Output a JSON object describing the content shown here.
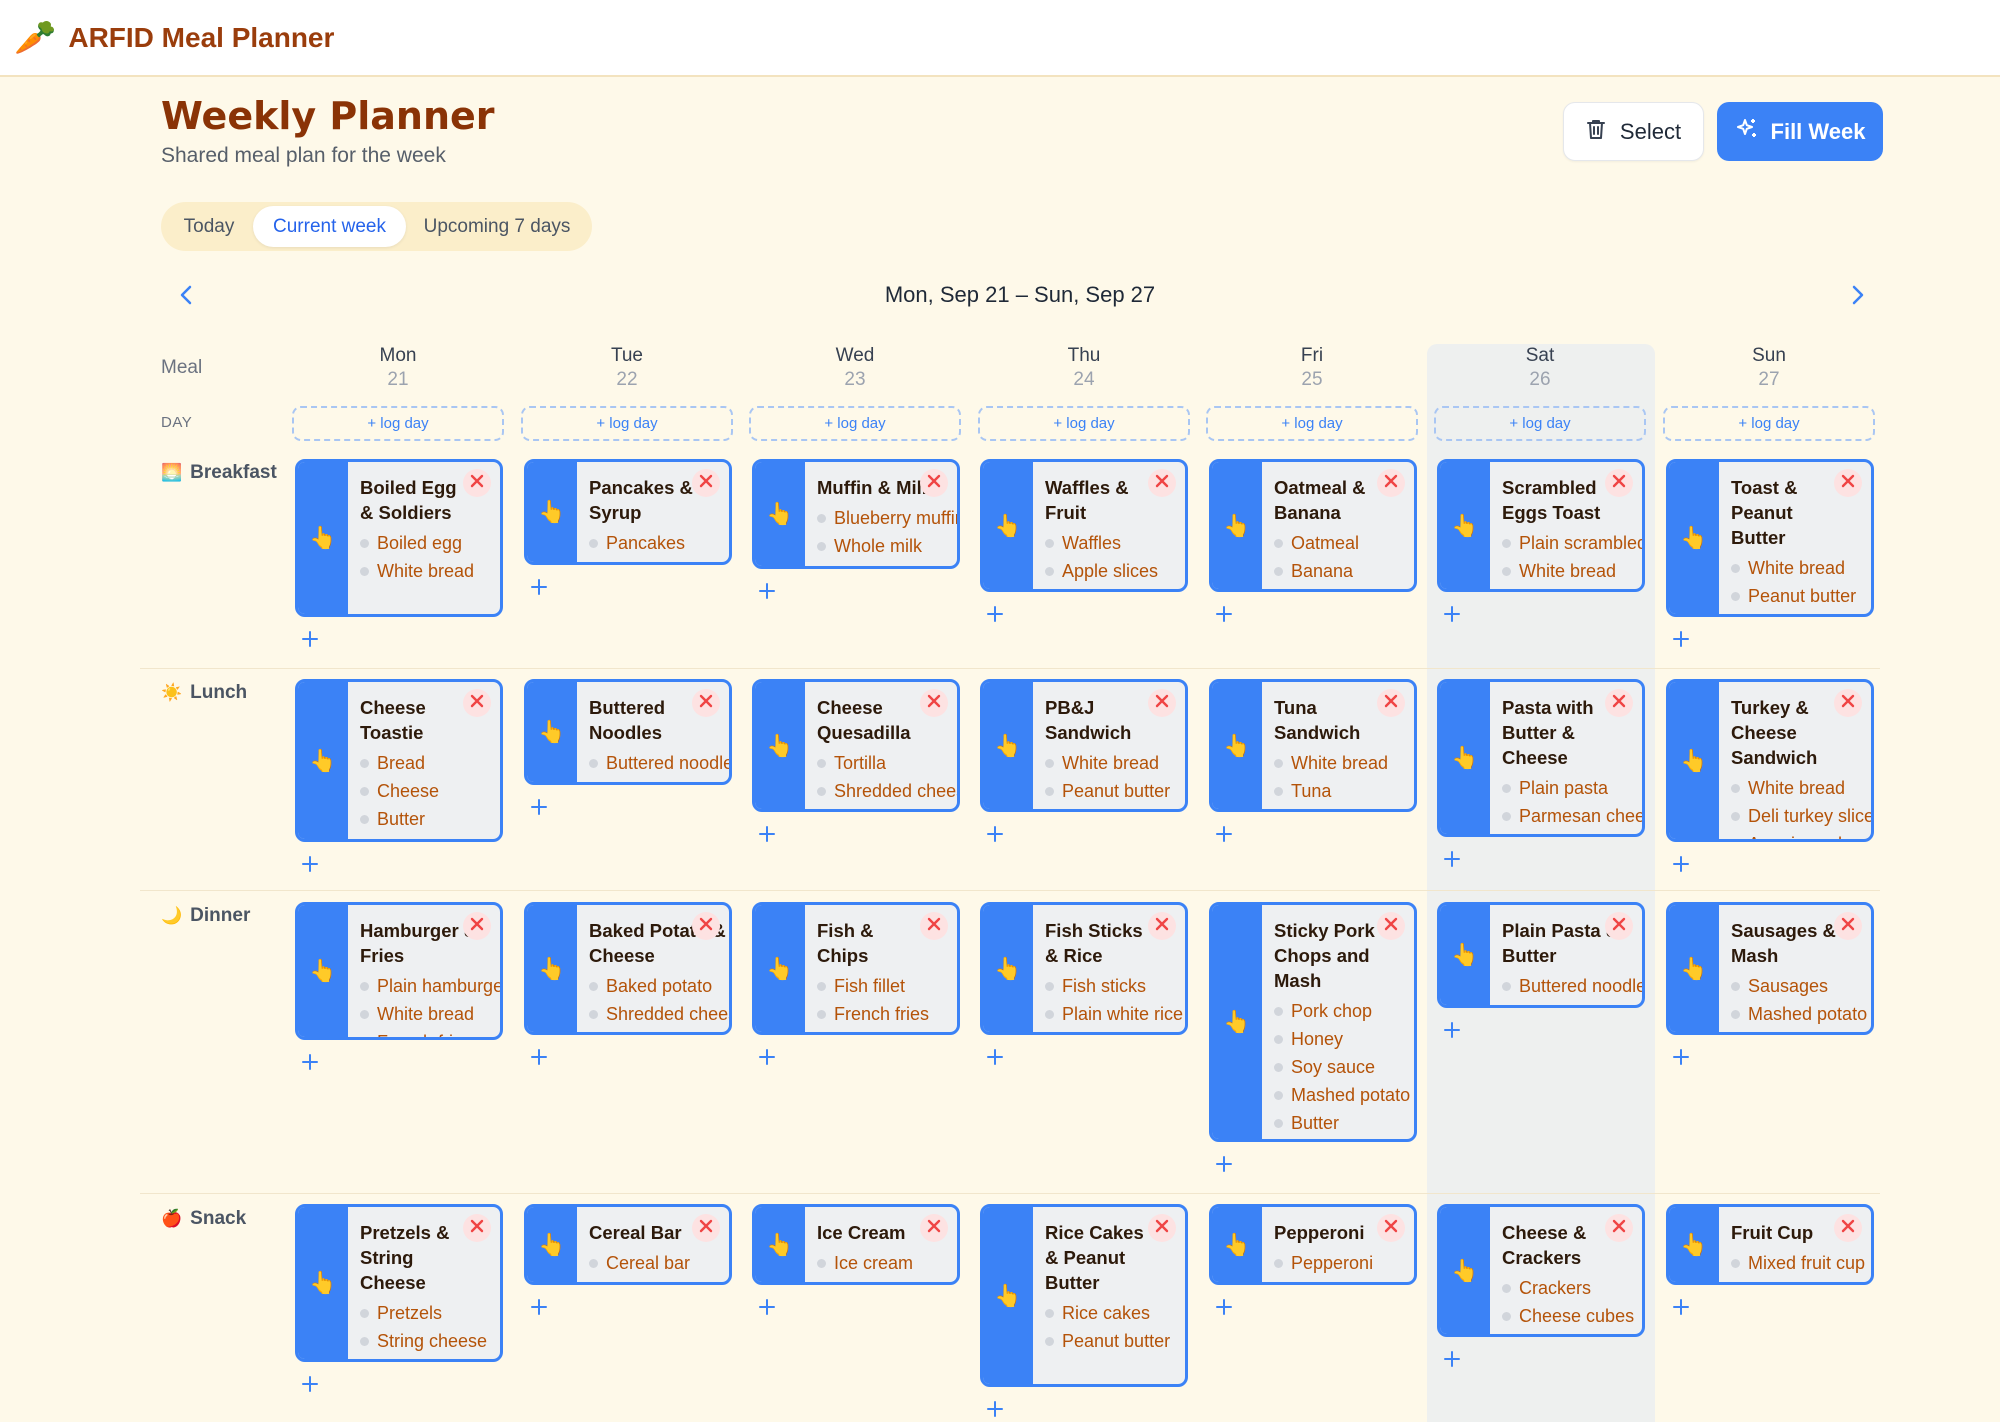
{
  "app": {
    "title": "ARFID Meal Planner",
    "logo_icon": "carrot-icon"
  },
  "header": {
    "title": "Weekly Planner",
    "subtitle": "Shared meal plan for the week"
  },
  "actions": {
    "select_label": "Select",
    "fill_week_label": "Fill Week"
  },
  "tabs": [
    {
      "label": "Today",
      "active": false
    },
    {
      "label": "Current week",
      "active": true
    },
    {
      "label": "Upcoming 7 days",
      "active": false
    }
  ],
  "date_range": "Mon, Sep 21 – Sun, Sep 27",
  "grid": {
    "meal_column_label": "Meal",
    "day_row_label": "DAY",
    "log_day_label": "+ log day",
    "highlighted_day": "Sat",
    "days": [
      {
        "name": "Mon",
        "num": "21"
      },
      {
        "name": "Tue",
        "num": "22"
      },
      {
        "name": "Wed",
        "num": "23"
      },
      {
        "name": "Thu",
        "num": "24"
      },
      {
        "name": "Fri",
        "num": "25"
      },
      {
        "name": "Sat",
        "num": "26"
      },
      {
        "name": "Sun",
        "num": "27"
      }
    ]
  },
  "rows": [
    {
      "label": "Breakfast",
      "emoji": "🌅",
      "meals": [
        {
          "title": "Boiled Egg & Soldiers",
          "items": [
            "Boiled egg",
            "White bread"
          ]
        },
        {
          "title": "Pancakes & Syrup",
          "items": [
            "Pancakes"
          ]
        },
        {
          "title": "Muffin & Milk",
          "items": [
            "Blueberry muffin",
            "Whole milk"
          ]
        },
        {
          "title": "Waffles & Fruit",
          "items": [
            "Waffles",
            "Apple slices"
          ]
        },
        {
          "title": "Oatmeal & Banana",
          "items": [
            "Oatmeal",
            "Banana"
          ]
        },
        {
          "title": "Scrambled Eggs Toast",
          "items": [
            "Plain scrambled eggs",
            "White bread"
          ]
        },
        {
          "title": "Toast & Peanut Butter",
          "items": [
            "White bread",
            "Peanut butter"
          ]
        }
      ]
    },
    {
      "label": "Lunch",
      "emoji": "☀️",
      "meals": [
        {
          "title": "Cheese Toastie",
          "items": [
            "Bread",
            "Cheese",
            "Butter"
          ]
        },
        {
          "title": "Buttered Noodles",
          "items": [
            "Buttered noodles"
          ]
        },
        {
          "title": "Cheese Quesadilla",
          "items": [
            "Tortilla",
            "Shredded cheese"
          ]
        },
        {
          "title": "PB&J Sandwich",
          "items": [
            "White bread",
            "Peanut butter"
          ]
        },
        {
          "title": "Tuna Sandwich",
          "items": [
            "White bread",
            "Tuna"
          ]
        },
        {
          "title": "Pasta with Butter & Cheese",
          "items": [
            "Plain pasta",
            "Parmesan cheese"
          ]
        },
        {
          "title": "Turkey & Cheese Sandwich",
          "items": [
            "White bread",
            "Deli turkey slices",
            "American cheese"
          ]
        }
      ]
    },
    {
      "label": "Dinner",
      "emoji": "🌙",
      "meals": [
        {
          "title": "Hamburger & Fries",
          "items": [
            "Plain hamburger",
            "White bread",
            "French fries"
          ]
        },
        {
          "title": "Baked Potato & Cheese",
          "items": [
            "Baked potato",
            "Shredded cheese"
          ]
        },
        {
          "title": "Fish & Chips",
          "items": [
            "Fish fillet",
            "French fries"
          ]
        },
        {
          "title": "Fish Sticks & Rice",
          "items": [
            "Fish sticks",
            "Plain white rice"
          ]
        },
        {
          "title": "Sticky Pork Chops and Mash",
          "items": [
            "Pork chop",
            "Honey",
            "Soy sauce",
            "Mashed potato",
            "Butter"
          ]
        },
        {
          "title": "Plain Pasta & Butter",
          "items": [
            "Buttered noodles"
          ]
        },
        {
          "title": "Sausages & Mash",
          "items": [
            "Sausages",
            "Mashed potato"
          ]
        }
      ]
    },
    {
      "label": "Snack",
      "emoji": "🍎",
      "meals": [
        {
          "title": "Pretzels & String Cheese",
          "items": [
            "Pretzels",
            "String cheese"
          ]
        },
        {
          "title": "Cereal Bar",
          "items": [
            "Cereal bar"
          ]
        },
        {
          "title": "Ice Cream",
          "items": [
            "Ice cream"
          ]
        },
        {
          "title": "Rice Cakes & Peanut Butter",
          "items": [
            "Rice cakes",
            "Peanut butter"
          ]
        },
        {
          "title": "Pepperoni",
          "items": [
            "Pepperoni"
          ]
        },
        {
          "title": "Cheese & Crackers",
          "items": [
            "Crackers",
            "Cheese cubes"
          ]
        },
        {
          "title": "Fruit Cup",
          "items": [
            "Mixed fruit cup"
          ]
        }
      ]
    }
  ],
  "colors": {
    "accent": "#3b82f6",
    "title": "#8a3306",
    "item_text": "#b45309",
    "background": "#fef9e9"
  },
  "icons": {
    "drag_handle": "pointing-hand-icon",
    "remove": "close-icon",
    "add": "plus-icon",
    "select": "trash-icon",
    "fill_week": "sparkles-icon"
  }
}
